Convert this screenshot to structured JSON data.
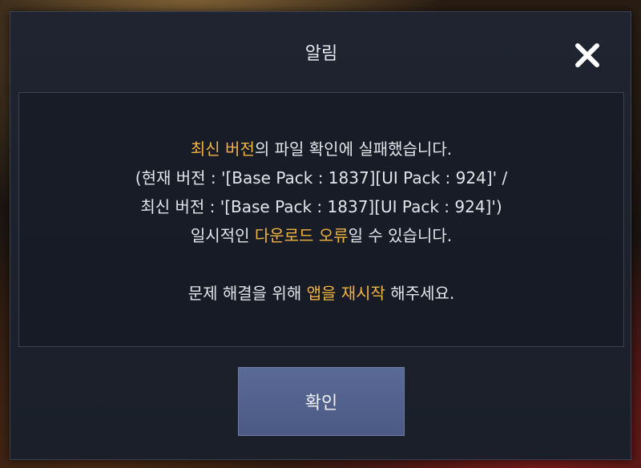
{
  "dialog": {
    "title": "알림",
    "close_icon": "close-icon",
    "confirm_label": "확인"
  },
  "message": {
    "line1": {
      "hl": "최신 버전",
      "rest": "의 파일 확인에 실패했습니다."
    },
    "line2": "(현재 버전 : '[Base Pack : 1837][UI Pack : 924]' /",
    "line3": "최신 버전 : '[Base Pack : 1837][UI Pack : 924]')",
    "line4": {
      "pre": "일시적인 ",
      "hl": "다운로드 오류",
      "post": "일 수 있습니다."
    },
    "line5": {
      "pre": "문제 해결을 위해 ",
      "hl": "앱을 재시작",
      "post": " 해주세요."
    }
  },
  "colors": {
    "highlight": "#f2b440",
    "text": "#e3e5ea",
    "button": "#4f5e8a",
    "panel": "#1d2230"
  }
}
